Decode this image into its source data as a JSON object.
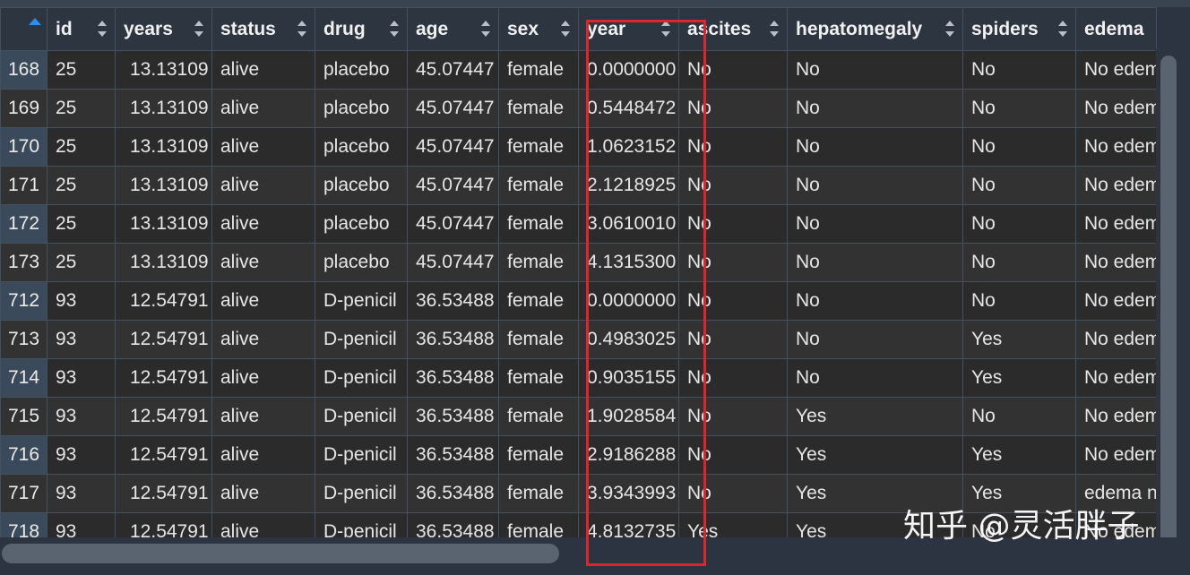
{
  "columns": [
    {
      "key": "rownum",
      "label": ""
    },
    {
      "key": "id",
      "label": "id"
    },
    {
      "key": "years",
      "label": "years"
    },
    {
      "key": "status",
      "label": "status"
    },
    {
      "key": "drug",
      "label": "drug"
    },
    {
      "key": "age",
      "label": "age"
    },
    {
      "key": "sex",
      "label": "sex"
    },
    {
      "key": "year",
      "label": "year"
    },
    {
      "key": "ascites",
      "label": "ascites"
    },
    {
      "key": "hepatomegaly",
      "label": "hepatomegaly"
    },
    {
      "key": "spiders",
      "label": "spiders"
    },
    {
      "key": "edema",
      "label": "edema"
    }
  ],
  "rows": [
    [
      "168",
      "25",
      "13.13109",
      "alive",
      "placebo",
      "45.07447",
      "female",
      "0.0000000",
      "No",
      "No",
      "No",
      "No edem"
    ],
    [
      "169",
      "25",
      "13.13109",
      "alive",
      "placebo",
      "45.07447",
      "female",
      "0.5448472",
      "No",
      "No",
      "No",
      "No edem"
    ],
    [
      "170",
      "25",
      "13.13109",
      "alive",
      "placebo",
      "45.07447",
      "female",
      "1.0623152",
      "No",
      "No",
      "No",
      "No edem"
    ],
    [
      "171",
      "25",
      "13.13109",
      "alive",
      "placebo",
      "45.07447",
      "female",
      "2.1218925",
      "No",
      "No",
      "No",
      "No edem"
    ],
    [
      "172",
      "25",
      "13.13109",
      "alive",
      "placebo",
      "45.07447",
      "female",
      "3.0610010",
      "No",
      "No",
      "No",
      "No edem"
    ],
    [
      "173",
      "25",
      "13.13109",
      "alive",
      "placebo",
      "45.07447",
      "female",
      "4.1315300",
      "No",
      "No",
      "No",
      "No edem"
    ],
    [
      "712",
      "93",
      "12.54791",
      "alive",
      "D-penicil",
      "36.53488",
      "female",
      "0.0000000",
      "No",
      "No",
      "No",
      "No edem"
    ],
    [
      "713",
      "93",
      "12.54791",
      "alive",
      "D-penicil",
      "36.53488",
      "female",
      "0.4983025",
      "No",
      "No",
      "Yes",
      "No edem"
    ],
    [
      "714",
      "93",
      "12.54791",
      "alive",
      "D-penicil",
      "36.53488",
      "female",
      "0.9035155",
      "No",
      "No",
      "Yes",
      "No edem"
    ],
    [
      "715",
      "93",
      "12.54791",
      "alive",
      "D-penicil",
      "36.53488",
      "female",
      "1.9028584",
      "No",
      "Yes",
      "No",
      "No edem"
    ],
    [
      "716",
      "93",
      "12.54791",
      "alive",
      "D-penicil",
      "36.53488",
      "female",
      "2.9186288",
      "No",
      "Yes",
      "Yes",
      "No edem"
    ],
    [
      "717",
      "93",
      "12.54791",
      "alive",
      "D-penicil",
      "36.53488",
      "female",
      "3.9343993",
      "No",
      "Yes",
      "Yes",
      "edema n"
    ],
    [
      "718",
      "93",
      "12.54791",
      "alive",
      "D-penicil",
      "36.53488",
      "female",
      "4.8132735",
      "Yes",
      "Yes",
      "No",
      "No edem"
    ]
  ],
  "watermark": "知乎 @灵活胖子",
  "colors": {
    "highlight": "#e0242b",
    "sort_active": "#2f8ff0"
  }
}
